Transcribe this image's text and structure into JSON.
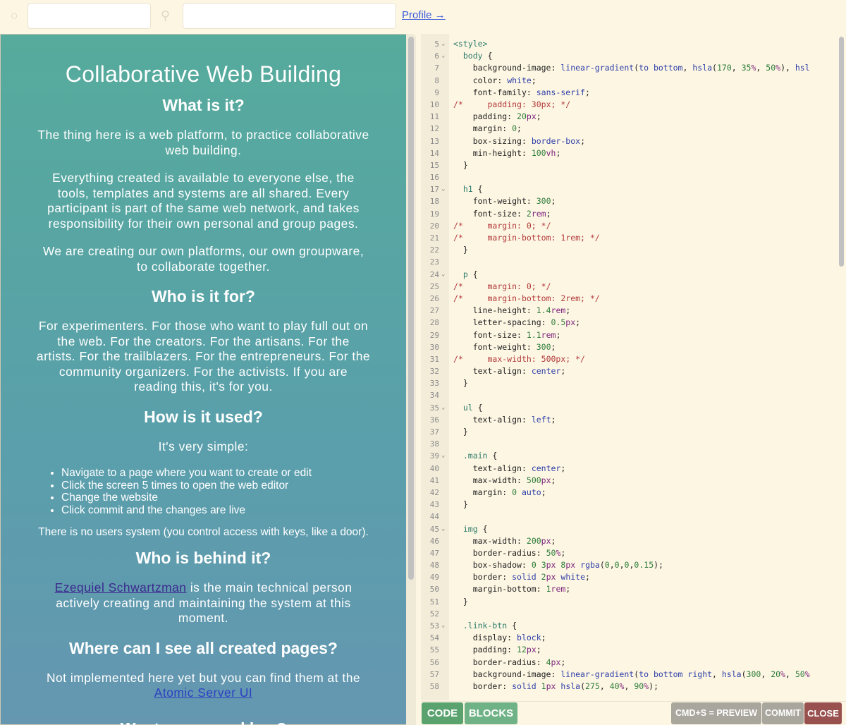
{
  "topbar": {
    "globe_icon": "globe-icon",
    "key_icon": "key-icon",
    "input1_value": "",
    "input2_value": "",
    "profile_link": "Profile →"
  },
  "preview": {
    "title": "Collaborative Web Building",
    "sections": [
      {
        "heading": "What is it?"
      },
      {
        "heading": "Who is it for?"
      },
      {
        "heading": "How is it used?"
      },
      {
        "heading": "Who is behind it?"
      },
      {
        "heading": "Where can I see all created pages?"
      },
      {
        "heading": "Want a personal key?"
      }
    ],
    "p1": "The thing here is a web platform, to practice collaborative web building.",
    "p2": "Everything created is available to everyone else, the tools, templates and systems are all shared. Every participant is part of the same web network, and takes responsibility for their own personal and group pages.",
    "p3": "We are creating our own platforms, our own groupware, to collaborate together.",
    "p4": "For experimenters. For those who want to play full out on the web. For the creators. For the artisans. For the artists. For the trailblazers. For the entrepreneurs. For the community organizers. For the activists. If you are reading this, it's for you.",
    "p5": "It's very simple:",
    "steps": [
      "Navigate to a page where you want to create or edit",
      "Click the screen 5 times to open the web editor",
      "Change the website",
      "Click commit and the changes are live"
    ],
    "p6": "There is no users system (you control access with keys, like a door).",
    "author_link": "Ezequiel Schwartzman",
    "p7_rest": " is the main technical person actively creating and maintaining the system at this moment.",
    "p8": "Not implemented here yet but you can find them at the",
    "atomic_link": "Atomic Server UI"
  },
  "editor": {
    "lines": [
      {
        "n": "5",
        "fold": "⌄",
        "t": "<style>"
      },
      {
        "n": "6",
        "fold": "⌄",
        "t": "  body {"
      },
      {
        "n": "7",
        "fold": "",
        "t": "    background-image: linear-gradient(to bottom, hsla(170, 35%, 50%), hsl"
      },
      {
        "n": "8",
        "fold": "",
        "t": "    color: white;"
      },
      {
        "n": "9",
        "fold": "",
        "t": "    font-family: sans-serif;"
      },
      {
        "n": "10",
        "fold": "",
        "t": "/*     padding: 30px; */"
      },
      {
        "n": "11",
        "fold": "",
        "t": "    padding: 20px;"
      },
      {
        "n": "12",
        "fold": "",
        "t": "    margin: 0;"
      },
      {
        "n": "13",
        "fold": "",
        "t": "    box-sizing: border-box;"
      },
      {
        "n": "14",
        "fold": "",
        "t": "    min-height: 100vh;"
      },
      {
        "n": "15",
        "fold": "",
        "t": "  }"
      },
      {
        "n": "16",
        "fold": "",
        "t": ""
      },
      {
        "n": "17",
        "fold": "⌄",
        "t": "  h1 {"
      },
      {
        "n": "18",
        "fold": "",
        "t": "    font-weight: 300;"
      },
      {
        "n": "19",
        "fold": "",
        "t": "    font-size: 2rem;"
      },
      {
        "n": "20",
        "fold": "",
        "t": "/*     margin: 0; */"
      },
      {
        "n": "21",
        "fold": "",
        "t": "/*     margin-bottom: 1rem; */"
      },
      {
        "n": "22",
        "fold": "",
        "t": "  }"
      },
      {
        "n": "23",
        "fold": "",
        "t": ""
      },
      {
        "n": "24",
        "fold": "⌄",
        "t": "  p {"
      },
      {
        "n": "25",
        "fold": "",
        "t": "/*     margin: 0; */"
      },
      {
        "n": "26",
        "fold": "",
        "t": "/*     margin-bottom: 2rem; */"
      },
      {
        "n": "27",
        "fold": "",
        "t": "    line-height: 1.4rem;"
      },
      {
        "n": "28",
        "fold": "",
        "t": "    letter-spacing: 0.5px;"
      },
      {
        "n": "29",
        "fold": "",
        "t": "    font-size: 1.1rem;"
      },
      {
        "n": "30",
        "fold": "",
        "t": "    font-weight: 300;"
      },
      {
        "n": "31",
        "fold": "",
        "t": "/*     max-width: 500px; */"
      },
      {
        "n": "32",
        "fold": "",
        "t": "    text-align: center;"
      },
      {
        "n": "33",
        "fold": "",
        "t": "  }"
      },
      {
        "n": "34",
        "fold": "",
        "t": ""
      },
      {
        "n": "35",
        "fold": "⌄",
        "t": "  ul {"
      },
      {
        "n": "36",
        "fold": "",
        "t": "    text-align: left;"
      },
      {
        "n": "37",
        "fold": "",
        "t": "  }"
      },
      {
        "n": "38",
        "fold": "",
        "t": ""
      },
      {
        "n": "39",
        "fold": "⌄",
        "t": "  .main {"
      },
      {
        "n": "40",
        "fold": "",
        "t": "    text-align: center;"
      },
      {
        "n": "41",
        "fold": "",
        "t": "    max-width: 500px;"
      },
      {
        "n": "42",
        "fold": "",
        "t": "    margin: 0 auto;"
      },
      {
        "n": "43",
        "fold": "",
        "t": "  }"
      },
      {
        "n": "44",
        "fold": "",
        "t": ""
      },
      {
        "n": "45",
        "fold": "⌄",
        "t": "  img {"
      },
      {
        "n": "46",
        "fold": "",
        "t": "    max-width: 200px;"
      },
      {
        "n": "47",
        "fold": "",
        "t": "    border-radius: 50%;"
      },
      {
        "n": "48",
        "fold": "",
        "t": "    box-shadow: 0 3px 8px rgba(0,0,0,0.15);"
      },
      {
        "n": "49",
        "fold": "",
        "t": "    border: solid 2px white;"
      },
      {
        "n": "50",
        "fold": "",
        "t": "    margin-bottom: 1rem;"
      },
      {
        "n": "51",
        "fold": "",
        "t": "  }"
      },
      {
        "n": "52",
        "fold": "",
        "t": ""
      },
      {
        "n": "53",
        "fold": "⌄",
        "t": "  .link-btn {"
      },
      {
        "n": "54",
        "fold": "",
        "t": "    display: block;"
      },
      {
        "n": "55",
        "fold": "",
        "t": "    padding: 12px;"
      },
      {
        "n": "56",
        "fold": "",
        "t": "    border-radius: 4px;"
      },
      {
        "n": "57",
        "fold": "",
        "t": "    background-image: linear-gradient(to bottom right, hsla(300, 20%, 50%"
      },
      {
        "n": "58",
        "fold": "",
        "t": "    border: solid 1px hsla(275, 40%, 90%);"
      }
    ]
  },
  "toolbar": {
    "code": "CODE",
    "blocks": "BLOCKS",
    "preview": "CMD+S = PREVIEW",
    "commit": "COMMIT",
    "close": "CLOSE"
  }
}
